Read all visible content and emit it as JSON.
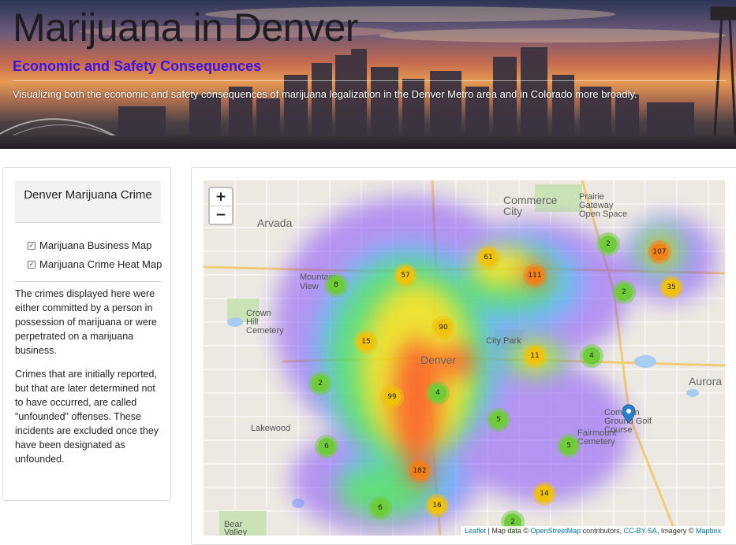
{
  "header": {
    "title": "Marijuana in Denver",
    "subtitle": "Economic and Safety Consequences",
    "description": "Visualizing both the economic and safety consequences of marijuana legalization in the Denver Metro area and in Colorado more broadly."
  },
  "sidebar": {
    "title": "Denver Marijuana Crime",
    "layers": [
      {
        "label": "Marijuana Business Map",
        "checked": true
      },
      {
        "label": "Marijuana Crime Heat Map",
        "checked": true
      }
    ],
    "paragraphs": [
      "The crimes displayed here were either committed by a person in possession of marijuana or were perpetrated on a marijuana business.",
      "Crimes that are initially reported, but that are later determined not to have occurred, are called \"unfounded\" offenses. These incidents are excluded once they have been designated as unfounded."
    ]
  },
  "map": {
    "zoom_in": "+",
    "zoom_out": "−",
    "places": {
      "arvada": "Arvada",
      "commerce_city": "Commerce City",
      "prairie_gateway": "Prairie Gateway Open Space",
      "mountain_view": "Mountain View",
      "crown_hill": "Crown Hill Cemetery",
      "denver": "Denver",
      "city_park": "City Park",
      "aurora": "Aurora",
      "lakewood": "Lakewood",
      "fairmount": "Fairmount Cemetery",
      "common_ground": "Common Ground Golf Course",
      "bear_valley": "Bear Valley Open Space"
    },
    "clusters": [
      {
        "count": "2",
        "size": "s"
      },
      {
        "count": "107",
        "size": "l"
      },
      {
        "count": "61",
        "size": "m"
      },
      {
        "count": "111",
        "size": "l"
      },
      {
        "count": "57",
        "size": "m"
      },
      {
        "count": "8",
        "size": "s"
      },
      {
        "count": "2",
        "size": "s"
      },
      {
        "count": "35",
        "size": "m"
      },
      {
        "count": "90",
        "size": "m"
      },
      {
        "count": "15",
        "size": "m"
      },
      {
        "count": "11",
        "size": "m"
      },
      {
        "count": "4",
        "size": "s"
      },
      {
        "count": "2",
        "size": "s"
      },
      {
        "count": "99",
        "size": "m"
      },
      {
        "count": "4",
        "size": "s"
      },
      {
        "count": "5",
        "size": "s"
      },
      {
        "count": "5",
        "size": "s"
      },
      {
        "count": "6",
        "size": "s"
      },
      {
        "count": "182",
        "size": "l"
      },
      {
        "count": "14",
        "size": "m"
      },
      {
        "count": "6",
        "size": "s"
      },
      {
        "count": "16",
        "size": "m"
      },
      {
        "count": "2",
        "size": "s"
      }
    ],
    "attribution": {
      "leaflet": "Leaflet",
      "sep1": " | Map data © ",
      "osm": "OpenStreetMap",
      "sep2": " contributors, ",
      "license": "CC-BY-SA",
      "sep3": ", Imagery © ",
      "mapbox": "Mapbox"
    }
  }
}
